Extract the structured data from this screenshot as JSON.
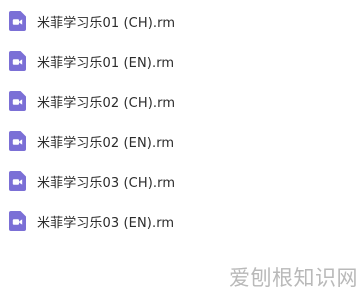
{
  "files": [
    {
      "name": "米菲学习乐01 (CH).rm",
      "icon": "video-file-icon"
    },
    {
      "name": "米菲学习乐01 (EN).rm",
      "icon": "video-file-icon"
    },
    {
      "name": "米菲学习乐02 (CH).rm",
      "icon": "video-file-icon"
    },
    {
      "name": "米菲学习乐02 (EN).rm",
      "icon": "video-file-icon"
    },
    {
      "name": "米菲学习乐03 (CH).rm",
      "icon": "video-file-icon"
    },
    {
      "name": "米菲学习乐03 (EN).rm",
      "icon": "video-file-icon"
    }
  ],
  "watermark": "爱刨根知识网",
  "colors": {
    "icon_accent": "#7b6fd6",
    "text": "#2b2b2b",
    "watermark": "#b9b9b9"
  }
}
